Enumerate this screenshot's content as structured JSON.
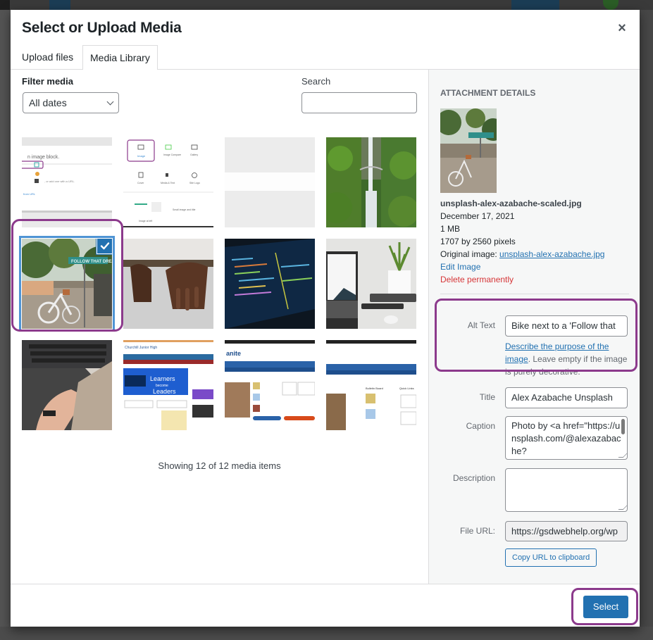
{
  "modal": {
    "title": "Select or Upload Media",
    "close_label": "×",
    "tabs": [
      {
        "label": "Upload files",
        "active": false
      },
      {
        "label": "Media Library",
        "active": true
      }
    ]
  },
  "filter": {
    "label": "Filter media",
    "date_selected": "All dates",
    "search_label": "Search",
    "search_value": ""
  },
  "media_items": [
    {
      "description": "Screenshot of image block insert menu",
      "selected": false
    },
    {
      "description": "Screenshot of block inserter with Image, Image Compare, Gallery, Cover, Media & Text, Site Logo",
      "selected": false
    },
    {
      "description": "Blank gray placeholder image",
      "selected": false
    },
    {
      "description": "Waterfall with bridge in green forest",
      "selected": false
    },
    {
      "description": "Bicycle next to Follow That Dream street sign",
      "selected": true
    },
    {
      "description": "Hands resting on a white surface",
      "selected": false
    },
    {
      "description": "Laptop with code on screen",
      "selected": false
    },
    {
      "description": "Laptop and potted plant on desk",
      "selected": false
    },
    {
      "description": "Hands typing on braille keyboard",
      "selected": false
    },
    {
      "description": "School website screenshot - Learners become Leaders",
      "selected": false
    },
    {
      "description": "Granite school district website screenshot",
      "selected": false
    },
    {
      "description": "School website bulletin board screenshot",
      "selected": false
    }
  ],
  "showing_text": "Showing 12 of 12 media items",
  "details": {
    "heading": "Attachment Details",
    "filename": "unsplash-alex-azabache-scaled.jpg",
    "date": "December 17, 2021",
    "size": "1 MB",
    "dimensions": "1707 by 2560 pixels",
    "original_label": "Original image:",
    "original_link": "unsplash-alex-azabache.jpg",
    "edit_label": "Edit Image",
    "delete_label": "Delete permanently"
  },
  "fields": {
    "alt_label": "Alt Text",
    "alt_value": "Bike next to a 'Follow that",
    "alt_help_link": "Describe the purpose of the image",
    "alt_help_text": ". Leave empty if the image is purely decorative.",
    "title_label": "Title",
    "title_value": "Alex Azabache Unsplash",
    "caption_label": "Caption",
    "caption_value": "Photo by <a href=\"https://unsplash.com/@alexazabache?",
    "description_label": "Description",
    "description_value": "",
    "url_label": "File URL:",
    "url_value": "https://gsdwebhelp.org/wp",
    "copy_label": "Copy URL to clipboard"
  },
  "footer": {
    "select_label": "Select"
  },
  "colors": {
    "accent": "#2271b1",
    "highlight": "#8c3a8c",
    "delete": "#d63638"
  }
}
